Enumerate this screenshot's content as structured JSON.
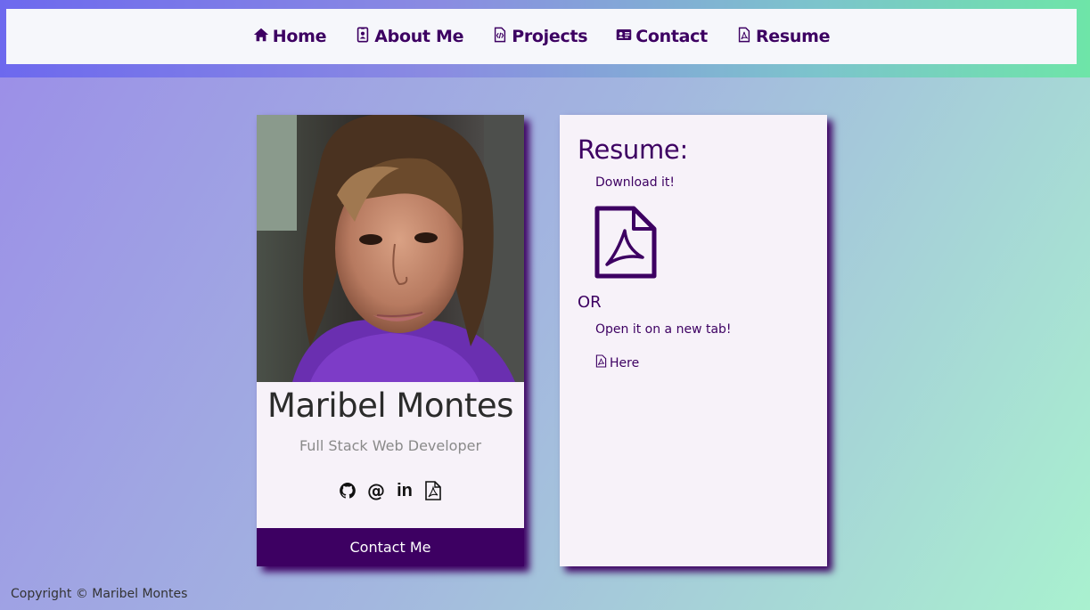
{
  "nav": {
    "items": [
      {
        "label": "Home",
        "icon": "home-icon"
      },
      {
        "label": "About Me",
        "icon": "id-badge-icon"
      },
      {
        "label": "Projects",
        "icon": "code-file-icon"
      },
      {
        "label": "Contact",
        "icon": "address-card-icon"
      },
      {
        "label": "Resume",
        "icon": "pdf-file-icon"
      }
    ]
  },
  "profile": {
    "name": "Maribel Montes",
    "title": "Full Stack Web Developer",
    "socials": {
      "github_icon": "github-icon",
      "email_label": "@",
      "linkedin_label": "in",
      "resume_icon": "pdf-file-icon"
    },
    "contact_button": "Contact Me"
  },
  "resume": {
    "heading": "Resume:",
    "download_text": "Download it!",
    "or_text": "OR",
    "open_text": "Open it on a new tab!",
    "here_link": "Here"
  },
  "footer": {
    "copyright": "Copyright © Maribel Montes"
  },
  "colors": {
    "accent": "#3d0062",
    "card_bg": "#f7f2f9",
    "nav_bg": "#f6f7fb"
  }
}
